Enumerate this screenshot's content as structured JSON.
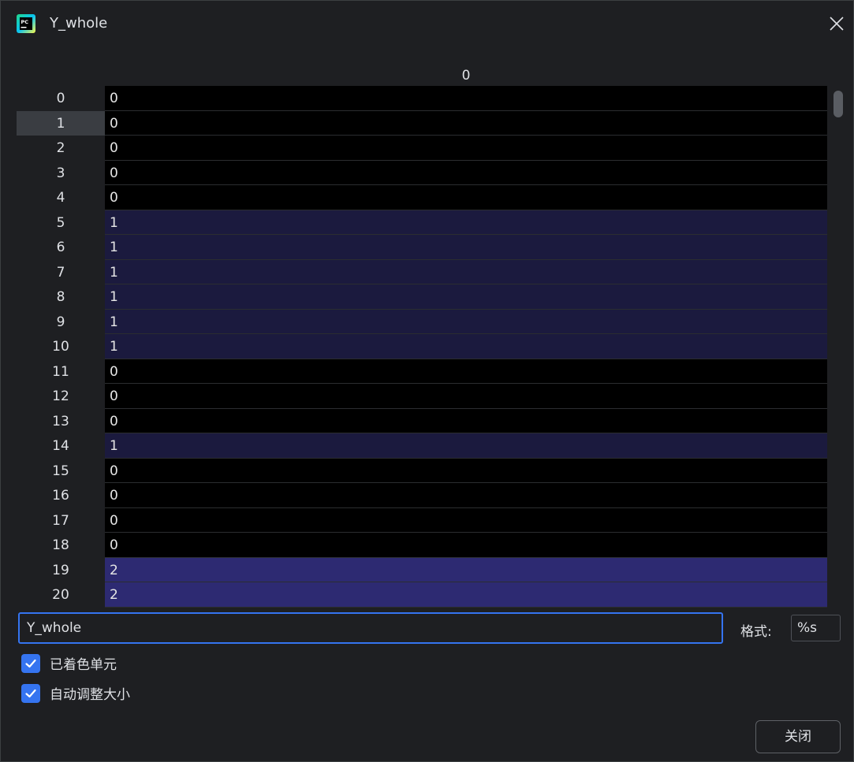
{
  "window": {
    "title": "Y_whole",
    "icon": "pycharm-icon"
  },
  "grid": {
    "column_header": "0",
    "selected_row": 1,
    "rows": [
      {
        "index": "0",
        "value": "0"
      },
      {
        "index": "1",
        "value": "0"
      },
      {
        "index": "2",
        "value": "0"
      },
      {
        "index": "3",
        "value": "0"
      },
      {
        "index": "4",
        "value": "0"
      },
      {
        "index": "5",
        "value": "1"
      },
      {
        "index": "6",
        "value": "1"
      },
      {
        "index": "7",
        "value": "1"
      },
      {
        "index": "8",
        "value": "1"
      },
      {
        "index": "9",
        "value": "1"
      },
      {
        "index": "10",
        "value": "1"
      },
      {
        "index": "11",
        "value": "0"
      },
      {
        "index": "12",
        "value": "0"
      },
      {
        "index": "13",
        "value": "0"
      },
      {
        "index": "14",
        "value": "1"
      },
      {
        "index": "15",
        "value": "0"
      },
      {
        "index": "16",
        "value": "0"
      },
      {
        "index": "17",
        "value": "0"
      },
      {
        "index": "18",
        "value": "0"
      },
      {
        "index": "19",
        "value": "2"
      },
      {
        "index": "20",
        "value": "2"
      }
    ],
    "value_colors": {
      "0": "#000000",
      "1": "#1b1a3e",
      "2": "#2d2a72"
    }
  },
  "controls": {
    "name_value": "Y_whole",
    "format_label": "格式:",
    "format_value": "%s",
    "colored_cells_label": "已着色单元",
    "colored_cells_checked": true,
    "auto_resize_label": "自动调整大小",
    "auto_resize_checked": true,
    "close_button_label": "关闭"
  },
  "colors": {
    "accent": "#3574f0",
    "background": "#1e1f22"
  }
}
